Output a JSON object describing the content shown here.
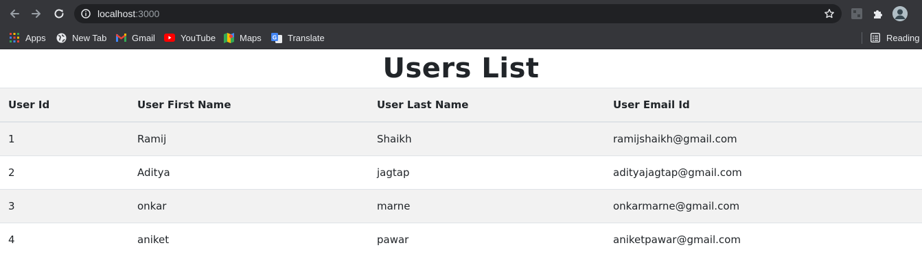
{
  "browser": {
    "url_host": "localhost",
    "url_port": ":3000",
    "bookmarks": [
      {
        "label": "Apps",
        "icon": "apps-grid-icon"
      },
      {
        "label": "New Tab",
        "icon": "globe-icon"
      },
      {
        "label": "Gmail",
        "icon": "gmail-icon"
      },
      {
        "label": "YouTube",
        "icon": "youtube-icon"
      },
      {
        "label": "Maps",
        "icon": "maps-icon"
      },
      {
        "label": "Translate",
        "icon": "translate-icon"
      }
    ],
    "reading_list": "Reading li"
  },
  "page": {
    "title": "Users List",
    "table": {
      "headers": [
        "User Id",
        "User First Name",
        "User Last Name",
        "User Email Id"
      ],
      "rows": [
        [
          "1",
          "Ramij",
          "Shaikh",
          "ramijshaikh@gmail.com"
        ],
        [
          "2",
          "Aditya",
          "jagtap",
          "adityajagtap@gmail.com"
        ],
        [
          "3",
          "onkar",
          "marne",
          "onkarmarne@gmail.com"
        ],
        [
          "4",
          "aniket",
          "pawar",
          "aniketpawar@gmail.com"
        ]
      ]
    }
  },
  "colors": {
    "chrome_bg": "#35363a",
    "omnibox_bg": "#202124",
    "striped_row": "#f2f2f2",
    "text": "#212529"
  }
}
